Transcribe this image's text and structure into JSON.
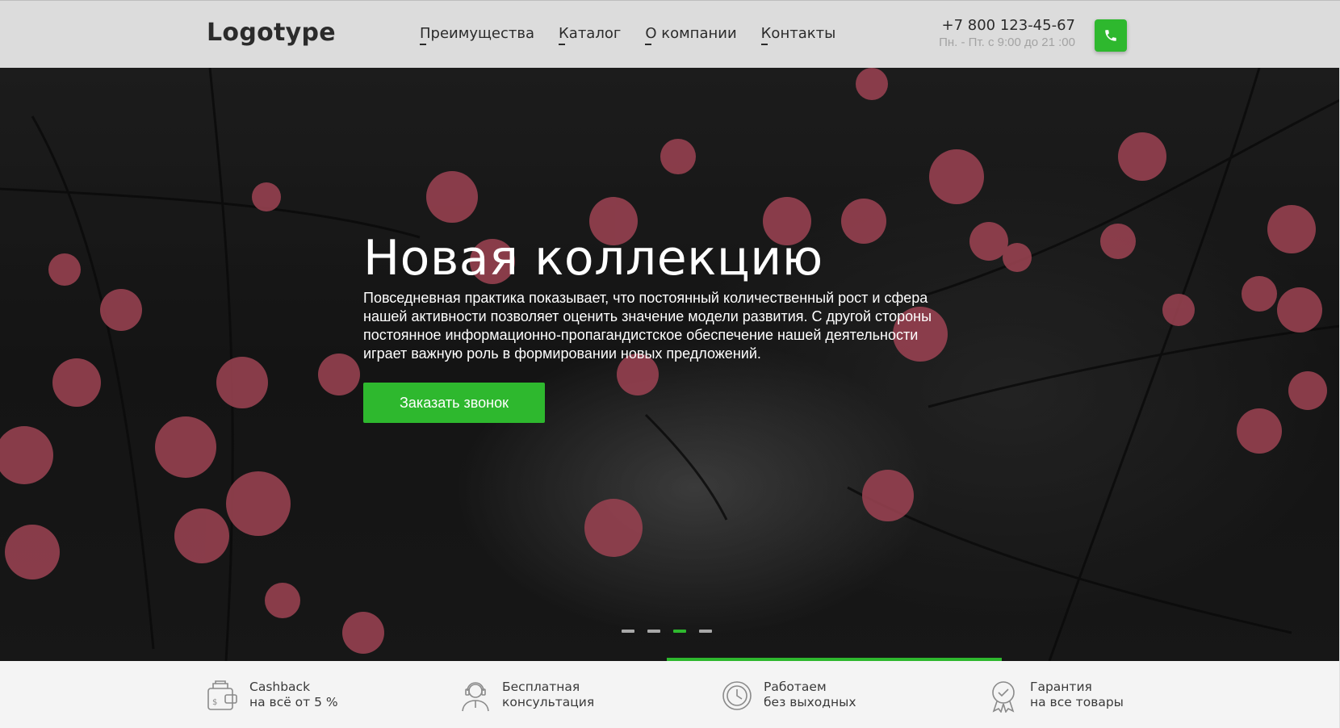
{
  "header": {
    "logo": "Logotype",
    "nav": [
      "Преимущества",
      "Каталог",
      "О компании",
      "Контакты"
    ],
    "phone": "+7 800 123-45-67",
    "hours": "Пн. - Пт. с 9:00 до 21 :00"
  },
  "hero": {
    "title": "Новая коллекцию",
    "text": "Повседневная практика показывает, что постоянный количественный рост и сфера нашей активности позволяет оценить значение модели развития. С другой стороны постоянное информационно-пропагандистское обеспечение нашей деятельности играет важную роль в формировании новых предложений.",
    "cta": "Заказать звонок",
    "slides_total": 4,
    "active_slide": 3
  },
  "features": [
    {
      "line1": "Cashback",
      "line2": "на всё от 5 %",
      "icon": "wallet-icon"
    },
    {
      "line1": "Бесплатная",
      "line2": "консультация",
      "icon": "support-agent-icon"
    },
    {
      "line1": "Работаем",
      "line2": "без выходных",
      "icon": "clock-icon"
    },
    {
      "line1": "Гарантия",
      "line2": "на все товары",
      "icon": "badge-check-icon"
    }
  ],
  "colors": {
    "accent": "#2eb82e",
    "header_bg": "#dcdcdc",
    "features_bg": "#f4f4f4"
  }
}
